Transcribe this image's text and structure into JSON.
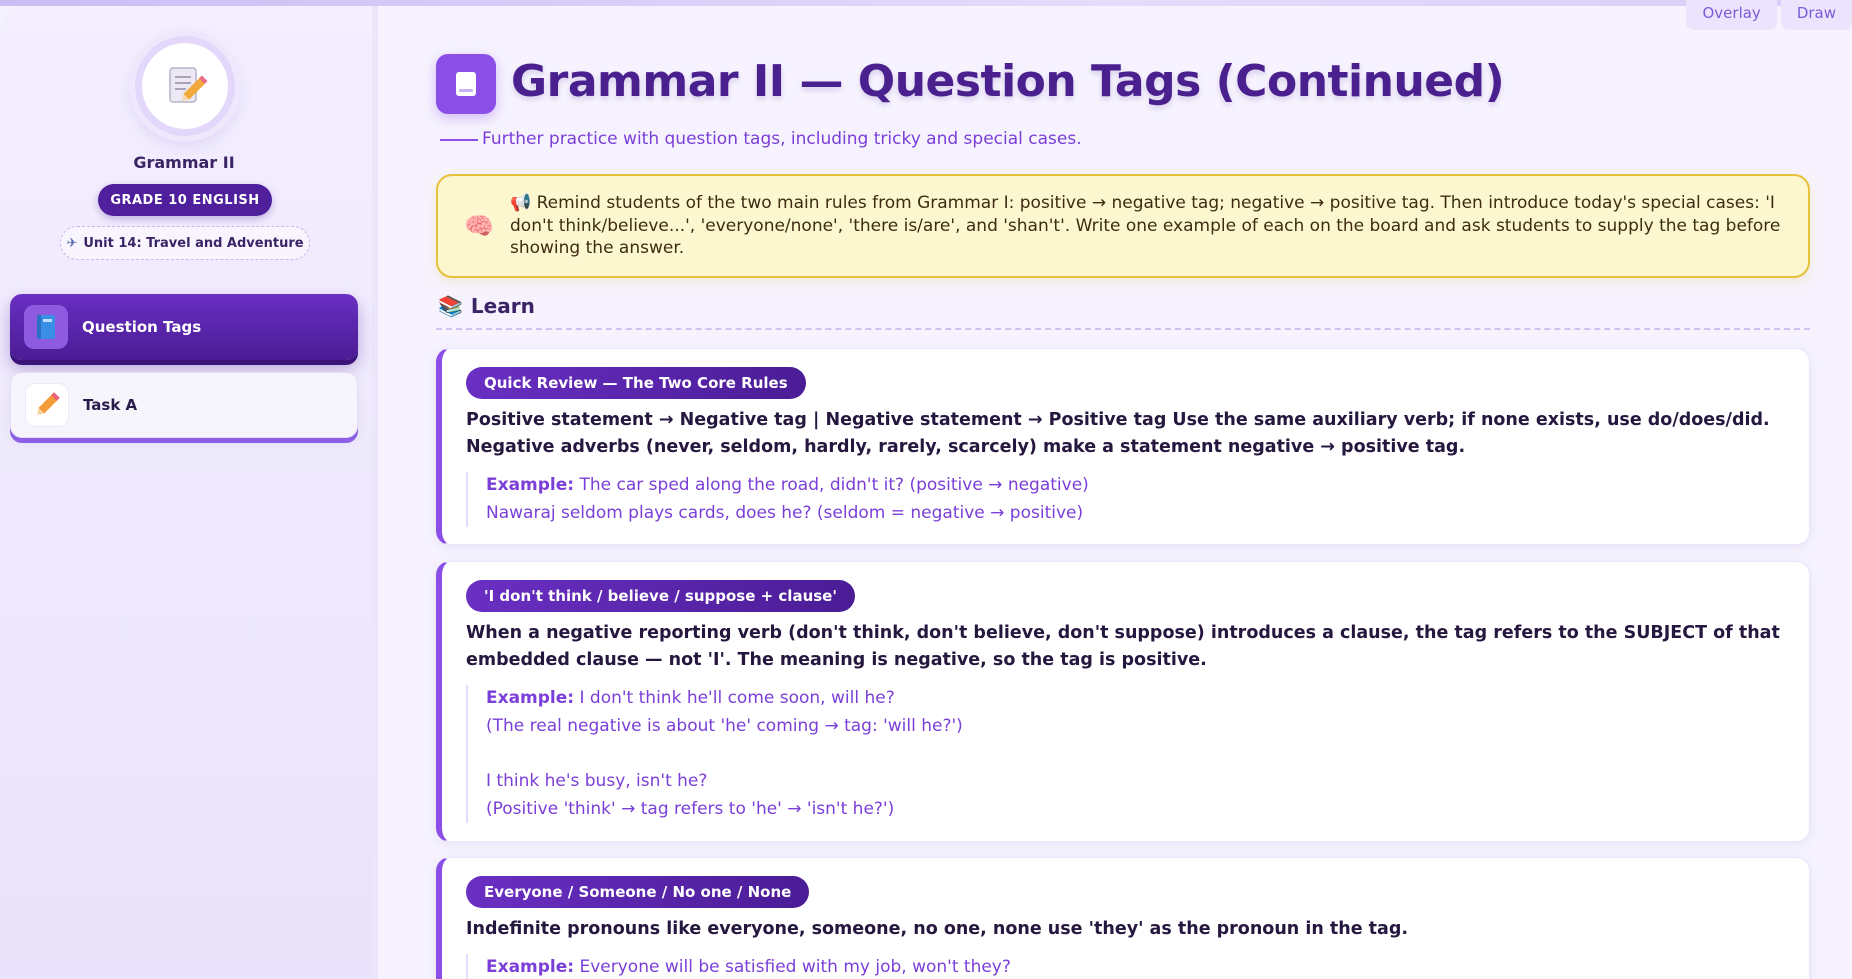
{
  "top_actions": {
    "overlay": "Overlay",
    "draw": "Draw"
  },
  "sidebar": {
    "logo_icon": "memo-pencil-icon",
    "title": "Grammar II",
    "grade": "GRADE 10 ENGLISH",
    "unit": "Unit 14: Travel and Adventure",
    "unit_icon": "airplane-icon",
    "items": [
      {
        "label": "Question Tags",
        "icon": "blue-book-icon",
        "active": true
      },
      {
        "label": "Task A",
        "icon": "pencil-icon",
        "active": false
      }
    ]
  },
  "main": {
    "title": "Grammar II — Question Tags (Continued)",
    "subtitle": "Further practice with question tags, including tricky and special cases.",
    "notice": {
      "icon": "brain-icon",
      "megaphone": "megaphone-icon",
      "text": "Remind students of the two main rules from Grammar I: positive → negative tag; negative → positive tag. Then introduce today's special cases: 'I don't think/believe...', 'everyone/none', 'there is/are', and 'shan't'. Write one example of each on the board and ask students to supply the tag before showing the answer."
    },
    "section": {
      "icon": "books-icon",
      "label": "Learn"
    },
    "cards": [
      {
        "pill": "Quick Review — The Two Core Rules",
        "body": "Positive statement → Negative tag | Negative statement → Positive tag Use the same auxiliary verb; if none exists, use do/does/did. Negative adverbs (never, seldom, hardly, rarely, scarcely) make a statement negative → positive tag.",
        "example_label": "Example:",
        "example_lines": [
          "The car sped along the road, didn't it? (positive → negative)",
          "Nawaraj seldom plays cards, does he? (seldom = negative → positive)"
        ]
      },
      {
        "pill": "'I don't think / believe / suppose + clause'",
        "body": "When a negative reporting verb (don't think, don't believe, don't suppose) introduces a clause, the tag refers to the SUBJECT of that embedded clause — not 'I'. The meaning is negative, so the tag is positive.",
        "example_label": "Example:",
        "example_lines": [
          "I don't think he'll come soon, will he?",
          "(The real negative is about 'he' coming → tag: 'will he?')",
          "",
          "I think he's busy, isn't he?",
          "(Positive 'think' → tag refers to 'he' → 'isn't he?')"
        ]
      },
      {
        "pill": "Everyone / Someone / No one / None",
        "body": "Indefinite pronouns like everyone, someone, no one, none use 'they' as the pronoun in the tag.",
        "example_label": "Example:",
        "example_lines": [
          "Everyone will be satisfied with my job, won't they?"
        ]
      }
    ]
  }
}
